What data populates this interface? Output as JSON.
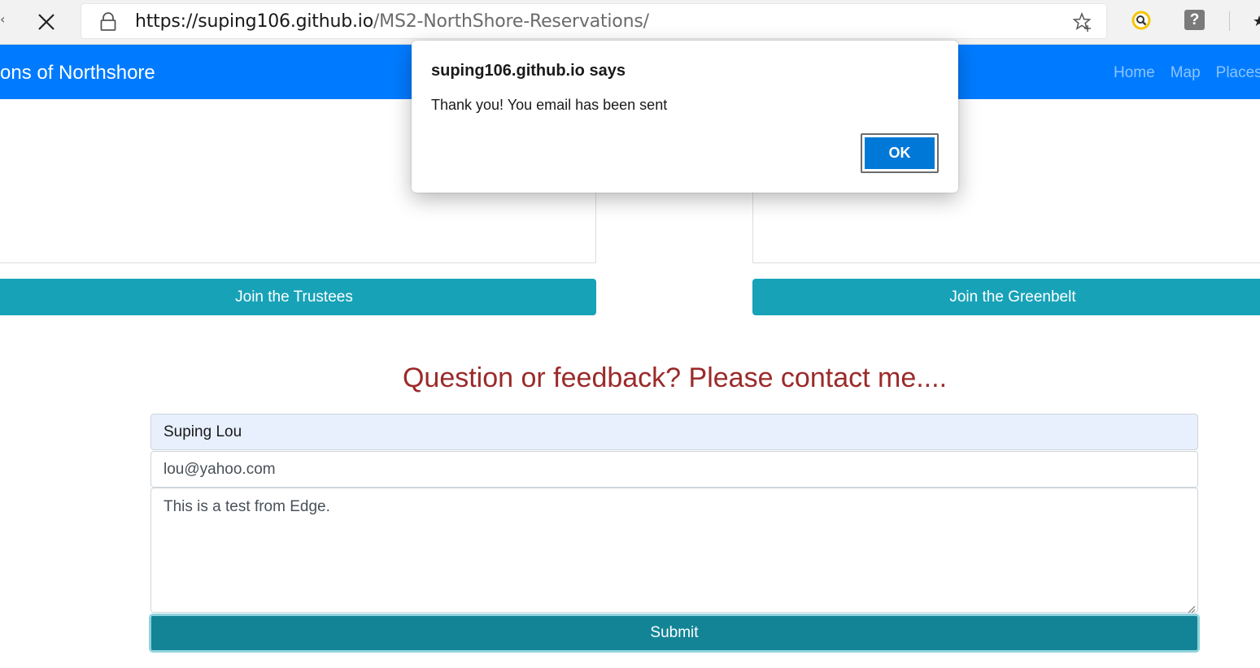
{
  "browser": {
    "url_host": "https://suping106.github.io",
    "url_path": "/MS2-NorthShore-Reservations/",
    "icons": [
      "close-icon",
      "lock-icon",
      "favorite-star-icon",
      "extension-icon",
      "help-icon"
    ],
    "help_label": "?"
  },
  "navbar": {
    "brand": "ons of Northshore",
    "links": [
      "Home",
      "Map",
      "Places"
    ],
    "color": "#007bff"
  },
  "cards": {
    "trustees_button": "Join the Trustees",
    "greenbelt_button": "Join the Greenbelt",
    "button_color": "#17a2b8"
  },
  "contact": {
    "title": "Question or feedback? Please contact me....",
    "title_color": "#9b2a2a",
    "name_value": "Suping Lou",
    "email_value": "lou@yahoo.com",
    "message_value": "This is a test from Edge.",
    "submit_label": "Submit"
  },
  "dialog": {
    "title": "suping106.github.io says",
    "message": "Thank you! You email has been sent",
    "ok_label": "OK",
    "ok_color": "#0078d7"
  }
}
